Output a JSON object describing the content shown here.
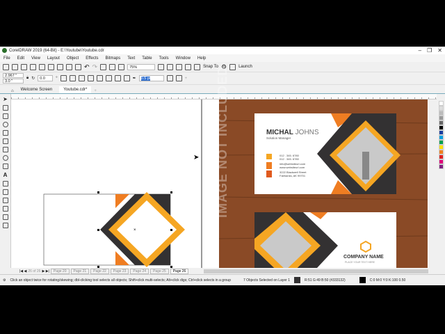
{
  "window": {
    "title": "CorelDRAW 2019 (64-Bit) - E:\\Youtube\\Youtube.cdr"
  },
  "menu": [
    "File",
    "Edit",
    "View",
    "Layout",
    "Object",
    "Effects",
    "Bitmaps",
    "Text",
    "Table",
    "Tools",
    "Window",
    "Help"
  ],
  "toolbar": {
    "zoom": "75%",
    "snap_to": "Snap To",
    "launch": "Launch"
  },
  "propbar": {
    "width": "2.967 \"",
    "height": "3.0 \"",
    "angle": "0.0",
    "outline": "0.5 pt"
  },
  "tabs": [
    {
      "label": "Welcome Screen"
    },
    {
      "label": "Youtube.cdr*"
    }
  ],
  "pages": {
    "nav": "26 of 26",
    "tabs": [
      "Page 20",
      "Page 21",
      "Page 22",
      "Page 23",
      "Page 24",
      "Page 25",
      "Page 26"
    ]
  },
  "status": {
    "hint": "Click an object twice for rotating/skewing; dbl-clicking tool selects all objects; Shift+click multi-selects; Alt+click digs; Ctrl+click selects in a group",
    "selection": "7 Objects Selected on Layer 1",
    "fill": "R:51 G:49 B:50 (#333132)",
    "outline": "C:0 M:0 Y:0 K:100  0.50"
  },
  "artwork": {
    "watermark": "IMAGE NOT INCLUDED",
    "name_first": "MICHAL",
    "name_last": "JOHNS",
    "role": "Solution Manager",
    "phone1": "012 . 345. 6780",
    "phone2": "012 . 345. 6780",
    "email": "info@websiteurl.com",
    "web": "www.websiteurl.com",
    "addr1": "3222 Blackwell Street",
    "addr2": "Fairbanks, AK 99701",
    "company": "COMPANY NAME",
    "tagline": "PLACE YOUR TEXT HERE"
  },
  "colors": {
    "orange": "#ef7d22",
    "yellow": "#f5a623",
    "dark": "#333132",
    "wood": "#8a4a26"
  }
}
